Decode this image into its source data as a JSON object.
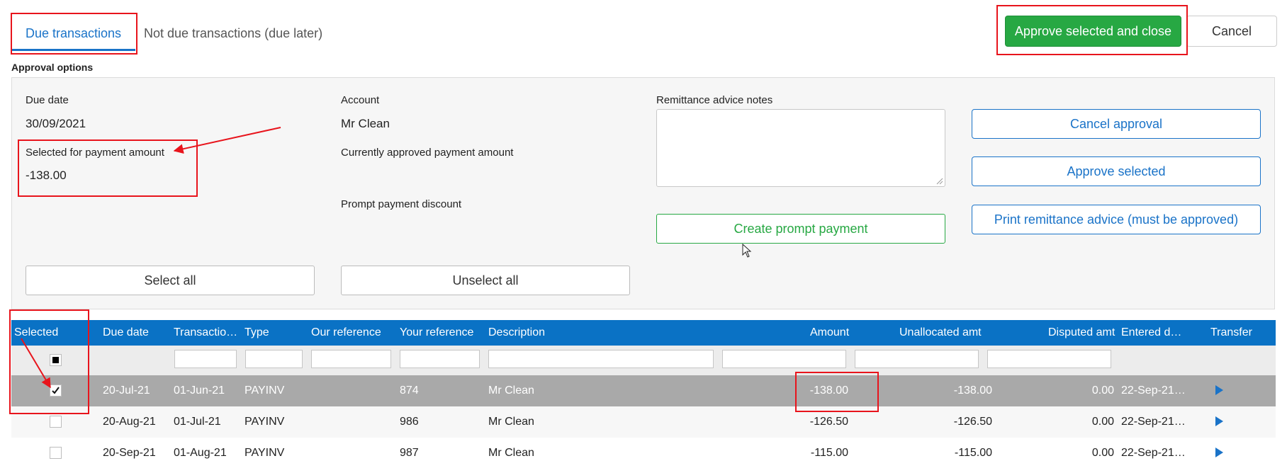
{
  "tabs": {
    "due": "Due transactions",
    "not_due": "Not due transactions (due later)"
  },
  "top_buttons": {
    "approve_close": "Approve selected and close",
    "cancel": "Cancel"
  },
  "approval_options": {
    "title": "Approval options",
    "due_date_label": "Due date",
    "due_date_value": "30/09/2021",
    "selected_amount_label": "Selected for payment amount",
    "selected_amount_value": "-138.00",
    "account_label": "Account",
    "account_value": "Mr Clean",
    "approved_amount_label": "Currently approved payment amount",
    "prompt_discount_label": "Prompt payment discount",
    "remittance_label": "Remittance advice notes",
    "remittance_value": "",
    "create_prompt_payment": "Create prompt payment",
    "cancel_approval": "Cancel approval",
    "approve_selected": "Approve selected",
    "print_remittance": "Print remittance advice (must be approved)",
    "select_all": "Select all",
    "unselect_all": "Unselect all"
  },
  "grid": {
    "columns": [
      "Selected",
      "Due date",
      "Transactio…",
      "Type",
      "Our reference",
      "Your reference",
      "Description",
      "Amount",
      "Unallocated amt",
      "Disputed amt",
      "Entered d…",
      "Transfer"
    ],
    "rows": [
      {
        "selected": true,
        "due_date": "20-Jul-21",
        "transaction": "01-Jun-21",
        "type": "PAYINV",
        "our_ref": "",
        "your_ref": "874",
        "description": "Mr Clean",
        "amount": "-138.00",
        "unallocated": "-138.00",
        "disputed": "0.00",
        "entered": "22-Sep-21…"
      },
      {
        "selected": false,
        "due_date": "20-Aug-21",
        "transaction": "01-Jul-21",
        "type": "PAYINV",
        "our_ref": "",
        "your_ref": "986",
        "description": "Mr Clean",
        "amount": "-126.50",
        "unallocated": "-126.50",
        "disputed": "0.00",
        "entered": "22-Sep-21…"
      },
      {
        "selected": false,
        "due_date": "20-Sep-21",
        "transaction": "01-Aug-21",
        "type": "PAYINV",
        "our_ref": "",
        "your_ref": "987",
        "description": "Mr Clean",
        "amount": "-115.00",
        "unallocated": "-115.00",
        "disputed": "0.00",
        "entered": "22-Sep-21…"
      }
    ]
  },
  "colors": {
    "accent_blue": "#0a72c5",
    "approve_green": "#27a843",
    "annotation_red": "#e8141c",
    "selected_row": "#a9a9a9"
  },
  "icons": {
    "transfer": "play-triangle-icon",
    "checked": "checkmark-icon",
    "header_checkbox": "indeterminate-square-icon"
  }
}
